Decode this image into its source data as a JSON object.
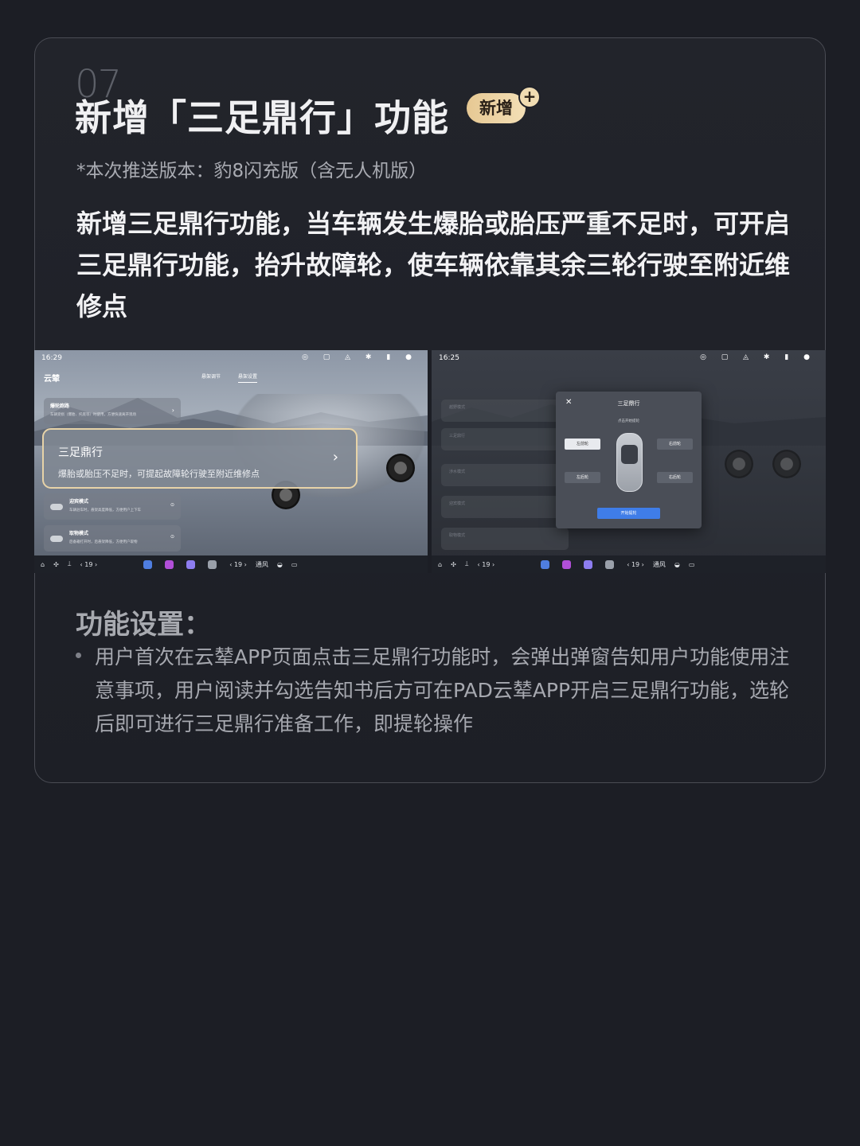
{
  "header": {
    "number": "07",
    "title": "新增「三足鼎行」功能",
    "badge": "新增",
    "badge_plus": "+",
    "version_note": "*本次推送版本：豹8闪充版（含无人机版）"
  },
  "description": "新增三足鼎行功能，当车辆发生爆胎或胎压严重不足时，可开启三足鼎行功能，抬升故障轮，使车辆依靠其余三轮行驶至附近维修点",
  "screenshot_left": {
    "time": "16:29",
    "status_icons": "◎ ▢ ◬ ✱ ▮ ●",
    "app_name": "云辇",
    "tabs": [
      "悬架调节",
      "悬架设置"
    ],
    "cards": [
      {
        "title": "爆轮跑路",
        "subtitle": "车辆受损（爆胎、托底等）时使用，方便快速离开现场"
      },
      {
        "title": "迎宾模式",
        "subtitle": "车辆驻车时，悬架高度降低，方便用户上下车"
      },
      {
        "title": "取物模式",
        "subtitle": "后备箱打开时，后悬架降低，方便用户取物"
      }
    ],
    "highlight": {
      "title": "三足鼎行",
      "subtitle": "爆胎或胎压不足时，可提起故障轮行驶至附近维修点",
      "chevron": "›"
    }
  },
  "screenshot_right": {
    "time": "16:25",
    "status_icons": "◎ ▢ ◬ ✱ ▮ ●",
    "dim_rows": [
      "越野模式",
      "三足鼎行",
      "涉水模式",
      "迎宾模式",
      "取物模式"
    ],
    "dialog": {
      "close": "✕",
      "title": "三足鼎行",
      "subtitle": "点击开始提轮",
      "wheels": {
        "front_left": "左前轮",
        "front_right": "右前轮",
        "rear_left": "左后轮",
        "rear_right": "右后轮"
      },
      "start_button": "开始提轮"
    }
  },
  "dock": {
    "home": "⌂",
    "fan": "✣",
    "seat": "⟘",
    "left_temp": "‹ 19 ›",
    "right_temp": "‹ 19 ›",
    "mode": "通风",
    "defrost": "◒",
    "rear": "▭"
  },
  "section": {
    "title": "功能设置：",
    "bullet": "用户首次在云辇APP页面点击三足鼎行功能时，会弹出弹窗告知用户功能使用注意事项，用户阅读并勾选告知书后方可在PAD云辇APP开启三足鼎行功能，选轮后即可进行三足鼎行准备工作，即提轮操作"
  },
  "colors": {
    "background": "#1c1e25",
    "badge_gold": "#e6c893",
    "highlight_border": "#e7d3a8",
    "start_button_blue": "#3f7de8"
  }
}
